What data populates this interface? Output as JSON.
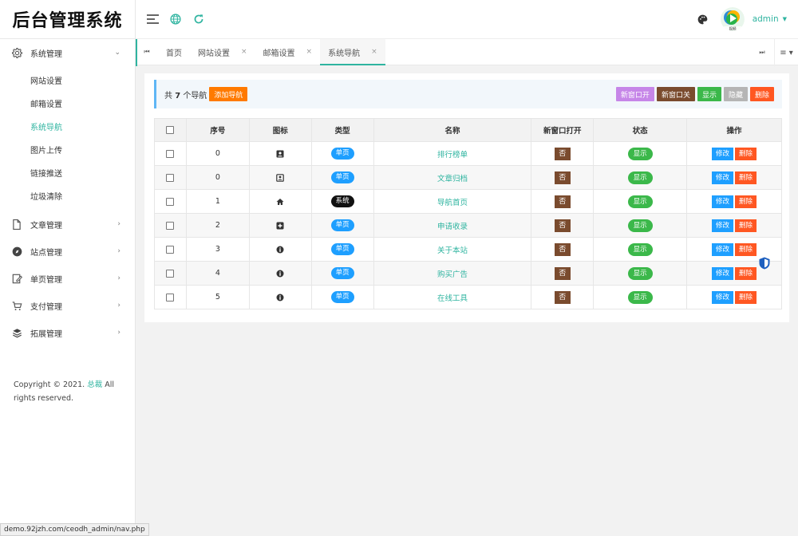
{
  "app": {
    "title": "后台管理系统"
  },
  "sidebar": {
    "items": [
      {
        "label": "系统管理",
        "icon": "gear-icon",
        "open": true
      },
      {
        "label": "文章管理",
        "icon": "document-icon"
      },
      {
        "label": "站点管理",
        "icon": "compass-icon"
      },
      {
        "label": "单页管理",
        "icon": "edit-page-icon"
      },
      {
        "label": "支付管理",
        "icon": "cart-icon"
      },
      {
        "label": "拓展管理",
        "icon": "layers-icon"
      }
    ],
    "submenu": [
      {
        "label": "网站设置"
      },
      {
        "label": "邮箱设置"
      },
      {
        "label": "系统导航",
        "active": true
      },
      {
        "label": "图片上传"
      },
      {
        "label": "链接推送"
      },
      {
        "label": "垃圾清除"
      }
    ],
    "copyright_prefix": "Copyright © 2021.",
    "copyright_link": "总裁",
    "copyright_suffix": "All rights reserved."
  },
  "header": {
    "user": "admin",
    "avatar_caption": "视频"
  },
  "tabs": {
    "items": [
      {
        "label": "首页",
        "closable": false
      },
      {
        "label": "网站设置",
        "closable": true
      },
      {
        "label": "邮箱设置",
        "closable": true
      },
      {
        "label": "系统导航",
        "closable": true,
        "active": true
      }
    ],
    "close_glyph": "×"
  },
  "toolbar": {
    "count_prefix": "共",
    "count_value": "7",
    "count_suffix": "个导航",
    "add_label": "添加导航",
    "buttons": {
      "open_new": "新窗口开",
      "close_new": "新窗口关",
      "show": "显示",
      "hide": "隐藏",
      "delete": "删除"
    }
  },
  "table": {
    "columns": [
      "序号",
      "图标",
      "类型",
      "名称",
      "新窗口打开",
      "状态",
      "操作"
    ],
    "rows": [
      {
        "order": "0",
        "icon": "user-card-icon",
        "type": "单页",
        "type_kind": "single",
        "name": "排行榜单",
        "new_window": "否",
        "status": "显示"
      },
      {
        "order": "0",
        "icon": "portrait-icon",
        "type": "单页",
        "type_kind": "single",
        "name": "文章归档",
        "new_window": "否",
        "status": "显示"
      },
      {
        "order": "1",
        "icon": "home-icon",
        "type": "系统",
        "type_kind": "system",
        "name": "导航首页",
        "new_window": "否",
        "status": "显示"
      },
      {
        "order": "2",
        "icon": "plus-square-icon",
        "type": "单页",
        "type_kind": "single",
        "name": "申请收录",
        "new_window": "否",
        "status": "显示"
      },
      {
        "order": "3",
        "icon": "info-icon",
        "type": "单页",
        "type_kind": "single",
        "name": "关于本站",
        "new_window": "否",
        "status": "显示"
      },
      {
        "order": "4",
        "icon": "info-icon",
        "type": "单页",
        "type_kind": "single",
        "name": "购买广告",
        "new_window": "否",
        "status": "显示"
      },
      {
        "order": "5",
        "icon": "info-icon",
        "type": "单页",
        "type_kind": "single",
        "name": "在线工具",
        "new_window": "否",
        "status": "显示"
      }
    ],
    "edit_label": "修改",
    "delete_label": "删除"
  },
  "statusbar": {
    "url": "demo.92jzh.com/ceodh_admin/nav.php"
  },
  "colors": {
    "accent": "#2fb4a0",
    "blue": "#1e9fff",
    "orange": "#ff7a00",
    "red": "#ff5722",
    "green": "#3bb84a",
    "brown": "#7a4b2e",
    "purple": "#c686e8"
  }
}
